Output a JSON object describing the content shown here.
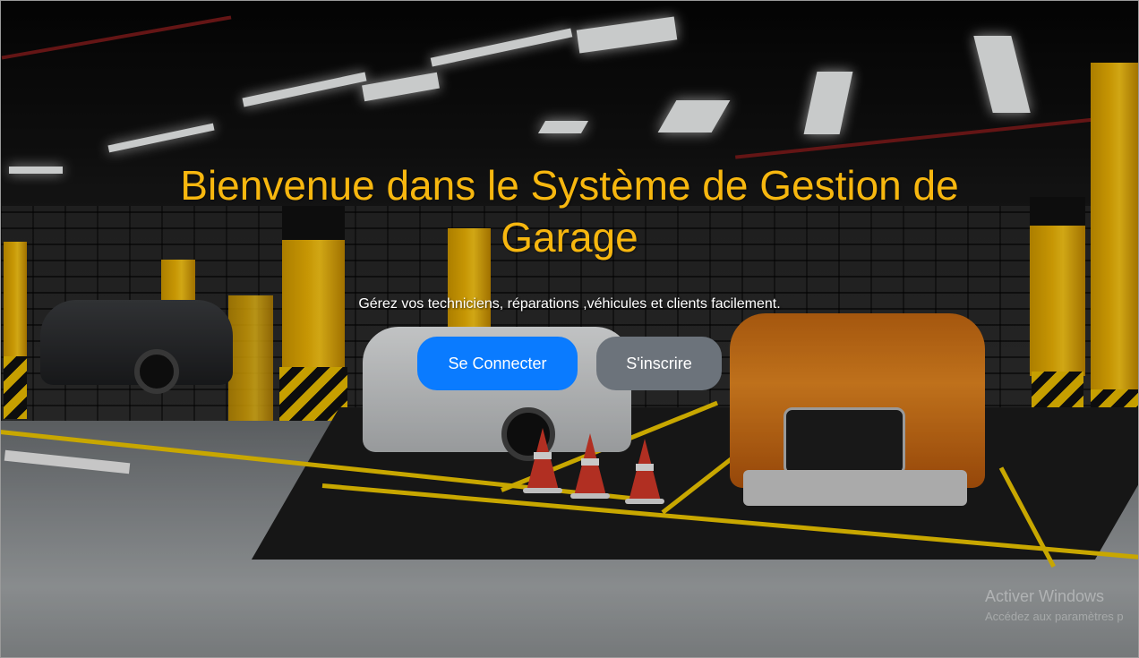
{
  "hero": {
    "title": "Bienvenue dans le Système de Gestion de Garage",
    "subtitle": "Gérez vos techniciens, réparations ,véhicules et clients facilement."
  },
  "actions": {
    "login_label": "Se Connecter",
    "signup_label": "S'inscrire"
  },
  "watermark": {
    "title": "Activer Windows",
    "subtitle": "Accédez aux paramètres p"
  },
  "colors": {
    "title": "#f7b70f",
    "primary_button": "#0a7bff",
    "secondary_button": "#6c737b"
  }
}
